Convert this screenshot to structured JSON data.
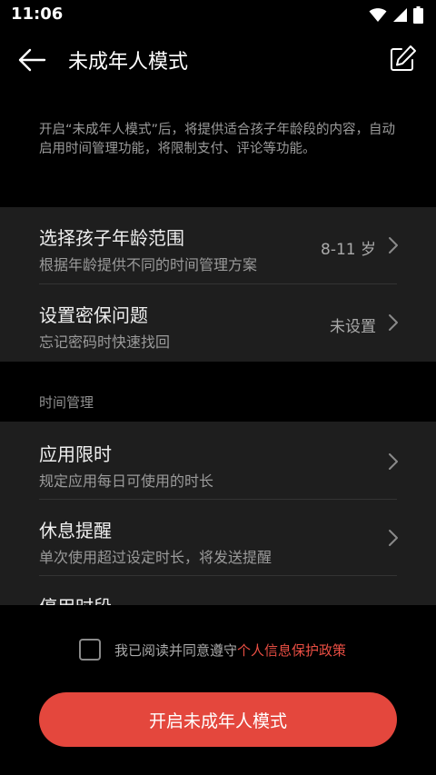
{
  "status_bar": {
    "time": "11:06",
    "icons": [
      "wifi-icon",
      "signal-icon",
      "battery-icon"
    ]
  },
  "app_bar": {
    "title": "未成年人模式",
    "back_icon": "back-arrow-icon",
    "action_icon": "edit-icon"
  },
  "intro_text": "开启“未成年人模式”后，将提供适合孩子年龄段的内容，自动启用时间管理功能，将限制支付、评论等功能。",
  "settings": [
    {
      "title": "选择孩子年龄范围",
      "subtitle": "根据年龄提供不同的时间管理方案",
      "value": "8-11 岁"
    },
    {
      "title": "设置密保问题",
      "subtitle": "忘记密码时快速找回",
      "value": "未设置"
    }
  ],
  "time_section": {
    "label": "时间管理",
    "items": [
      {
        "title": "应用限时",
        "subtitle": "规定应用每日可使用的时长"
      },
      {
        "title": "休息提醒",
        "subtitle": "单次使用超过设定时长，将发送提醒"
      },
      {
        "title": "停用时段",
        "subtitle": ""
      }
    ]
  },
  "consent": {
    "text": "我已阅读并同意遵守",
    "link": "个人信息保护政策",
    "checked": false
  },
  "primary_button": "开启未成年人模式",
  "colors": {
    "accent": "#e4473d",
    "link": "#e84e43",
    "background": "#000000",
    "card": "#1e1e1e"
  }
}
